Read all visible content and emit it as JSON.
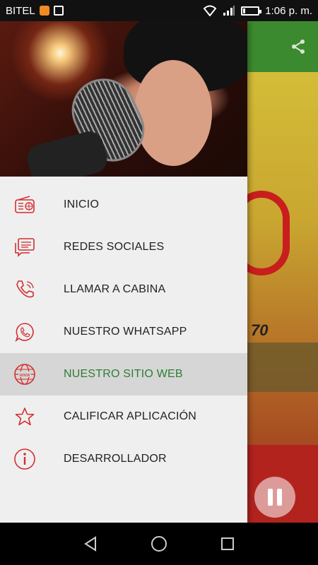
{
  "status_bar": {
    "carrier": "BITEL",
    "time": "1:06 p. m."
  },
  "drawer": {
    "menu": [
      {
        "label": "INICIO",
        "icon": "radio-icon",
        "active": false
      },
      {
        "label": "REDES SOCIALES",
        "icon": "chat-icon",
        "active": false
      },
      {
        "label": "LLAMAR A CABINA",
        "icon": "phone-icon",
        "active": false
      },
      {
        "label": "NUESTRO WHATSAPP",
        "icon": "whatsapp-icon",
        "active": false
      },
      {
        "label": "NUESTRO SITIO WEB",
        "icon": "globe-www-icon",
        "active": true
      },
      {
        "label": "CALIFICAR APLICACIÓN",
        "icon": "star-icon",
        "active": false
      },
      {
        "label": "DESARROLLADOR",
        "icon": "info-icon",
        "active": false
      }
    ]
  },
  "background_app": {
    "logo_fragment": "70"
  },
  "colors": {
    "accent_red": "#d32f2f",
    "active_text": "#2e7d32",
    "toolbar_green": "#3c8a2f"
  }
}
